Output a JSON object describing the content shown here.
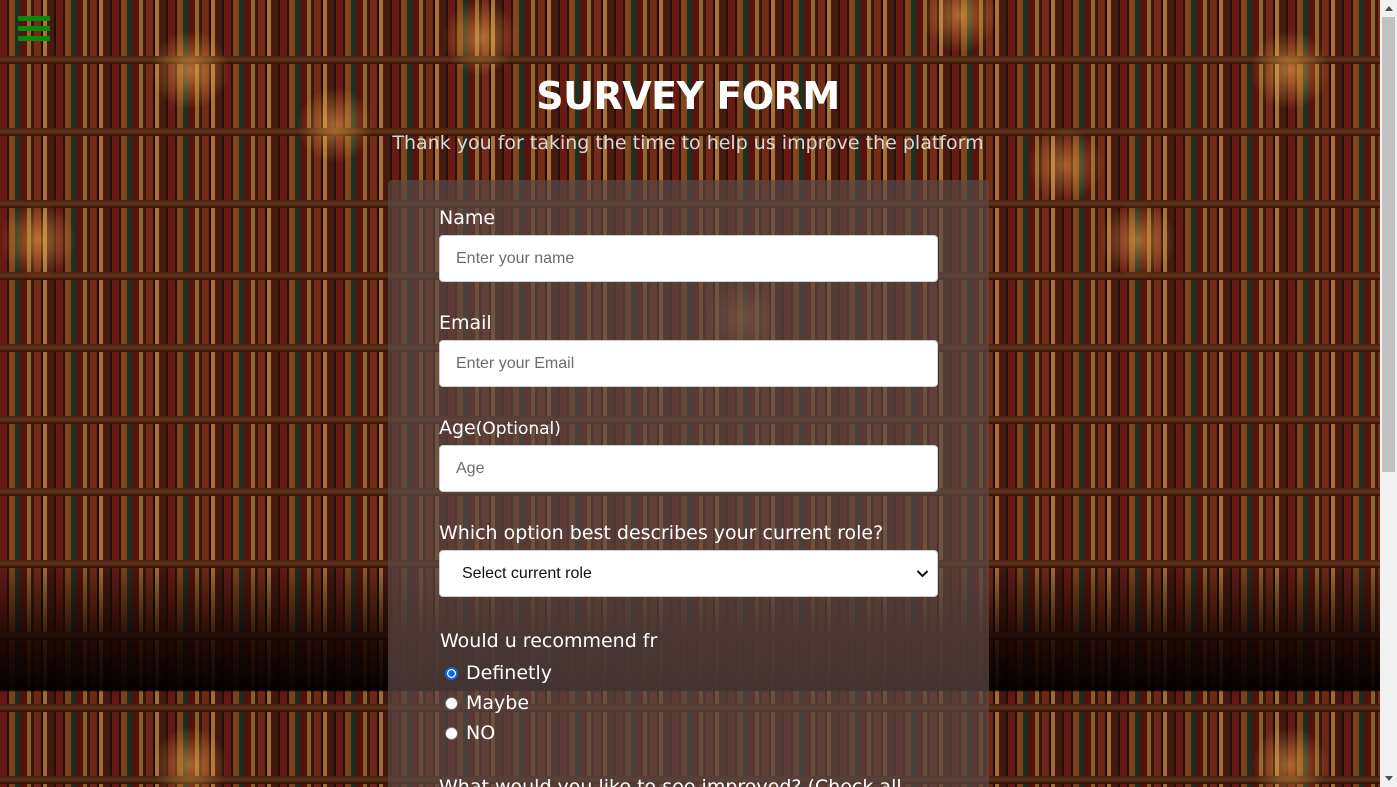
{
  "header": {
    "title": "SURVEY FORM",
    "subtitle": "Thank you for taking the time to help us improve the platform"
  },
  "menu": {
    "icon": "hamburger-menu-icon",
    "color": "#0a8a0a"
  },
  "form": {
    "name": {
      "label": "Name",
      "placeholder": "Enter your name"
    },
    "email": {
      "label": "Email",
      "placeholder": "Enter your Email"
    },
    "age": {
      "label": "Age",
      "optional": "(Optional)",
      "placeholder": "Age"
    },
    "role": {
      "label": "Which option best describes your current role?",
      "selected": "Select current role"
    },
    "recommend": {
      "label": "Would u recommend fr",
      "options": [
        {
          "label": "Definetly",
          "checked": true
        },
        {
          "label": "Maybe",
          "checked": false
        },
        {
          "label": "NO",
          "checked": false
        }
      ]
    },
    "next_question": "What would you like to see improved? (Check all"
  },
  "colors": {
    "radio_accent": "#0a68d8",
    "card_background": "rgba(92,72,68,0.72)"
  }
}
